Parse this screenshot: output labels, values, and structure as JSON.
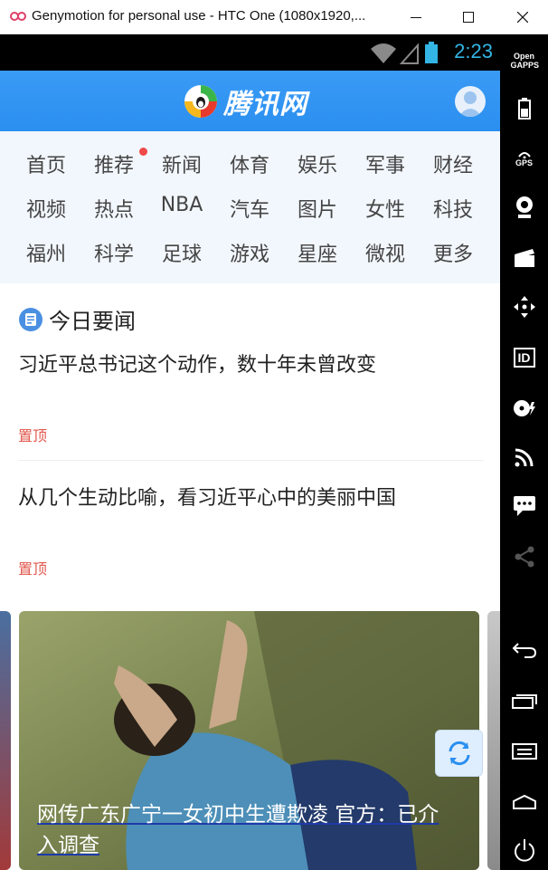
{
  "window": {
    "title": "Genymotion for personal use - HTC One (1080x1920,...",
    "minimize_label": "—",
    "maximize_label": "☐",
    "close_label": "✕"
  },
  "statusbar": {
    "time": "2:23"
  },
  "app": {
    "logo_text": "腾讯网",
    "nav": [
      [
        "首页",
        "推荐",
        "新闻",
        "体育",
        "娱乐",
        "军事",
        "财经"
      ],
      [
        "视频",
        "热点",
        "NBA",
        "汽车",
        "图片",
        "女性",
        "科技"
      ],
      [
        "福州",
        "科学",
        "足球",
        "游戏",
        "星座",
        "微视",
        "更多"
      ]
    ],
    "section_title": "今日要闻",
    "news": [
      {
        "title": "习近平总书记这个动作，数十年未曾改变",
        "tag": "置顶"
      },
      {
        "title": "从几个生动比喻，看习近平心中的美丽中国",
        "tag": "置顶"
      }
    ],
    "carousel_caption": "网传广东广宁一女初中生遭欺凌 官方：已介入调查"
  },
  "sidebar": {
    "opengapps_label": "Open GAPPS",
    "gps_label": "GPS",
    "id_label": "ID"
  },
  "colors": {
    "header_blue": "#2b8ff0",
    "status_time": "#33b5e5",
    "pin_red": "#e2574c",
    "nav_bg": "#f2f7fd"
  }
}
